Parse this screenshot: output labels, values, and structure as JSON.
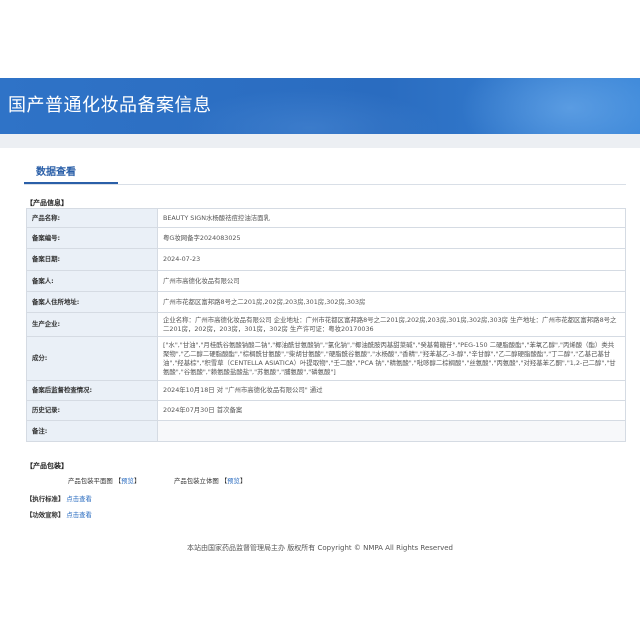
{
  "header": {
    "title": "国产普通化妆品备案信息"
  },
  "tabs": [
    {
      "label": "数据查看"
    }
  ],
  "sections": {
    "product_info": "【产品信息】",
    "product_package": "【产品包装】",
    "exec_standard": "【执行标准】",
    "efficacy": "【功效宣称】"
  },
  "rows": [
    {
      "key": "产品名称:",
      "value": "BEAUTY SIGN水杨酸祛痘控油洁面乳"
    },
    {
      "key": "备案编号:",
      "value": "粤G妆网备字2024083025"
    },
    {
      "key": "备案日期:",
      "value": "2024-07-23"
    },
    {
      "key": "备案人:",
      "value": "广州市高德化妆品有限公司"
    },
    {
      "key": "备案人住所地址:",
      "value": "广州市花都区富邦路8号之二201房,202房,203房,301房,302房,303房"
    },
    {
      "key": "生产企业:",
      "value": "企业名称：广州市高德化妆品有限公司 企业地址：广州市花都区富邦路8号之二201房,202房,203房,301房,302房,303房 生产地址：广州市花都区富邦路8号之二201房，202房，203房，301房，302房 生产许可证：粤妆20170036"
    },
    {
      "key": "成分:",
      "value": "[\"水\",\"甘油\",\"月桂酰谷氨酸钠酸二钠\",\"椰油酰甘氨酸钠\",\"氯化钠\",\"椰油酰胺丙基甜菜碱\",\"癸基葡糖苷\",\"PEG-150 二硬脂酸酯\",\"苯氧乙醇\",\"丙烯酸（酯）类共聚物\",\"乙二醇二硬脂酸酯\",\"棕榈酰甘氨酸\",\"柴胡甘氨酸\",\"硬脂酰谷氨酸\",\"水杨酸\",\"香精\",\"羟苯基乙-3-醇\",\"辛甘醇\",\"乙二醇硬脂酸酯\",\"丁二醇\",\"乙基己基甘油\",\"羟基棕\",\"积雪草（CENTELLA ASIATICA）叶提取物\",\"壬二酸\",\"PCA 钠\",\"精氨酸\",\"吡哆醇二棕榈酸\",\"丝氨酸\",\"丙氨酸\",\"对羟基苯乙酮\",\"1,2-己二醇\",\"甘氨酸\",\"谷氨酸\",\"赖氨酸盐酸盐\",\"苏氨酸\",\"脯氨酸\",\"磷氨酸\"]"
    },
    {
      "key": "备案后监督检查情况:",
      "value": "2024年10月18日 对 \"广州市高德化妆品有限公司\" 通过"
    },
    {
      "key": "历史记录:",
      "value": "2024年07月30日 首次备案"
    },
    {
      "key": "备注:",
      "value": ""
    }
  ],
  "package": {
    "flat_label": "产品包装平面图",
    "flat_link": "预览",
    "solid_label": "产品包装立体图",
    "solid_link": "预览",
    "bracket_open": "【",
    "bracket_close": "】"
  },
  "links": {
    "exec_standard_link": "点击查看",
    "efficacy_link": "点击查看"
  },
  "footer": {
    "text": "本站由国家药品监督管理局主办 版权所有 Copyright © NMPA All Rights Reserved"
  }
}
